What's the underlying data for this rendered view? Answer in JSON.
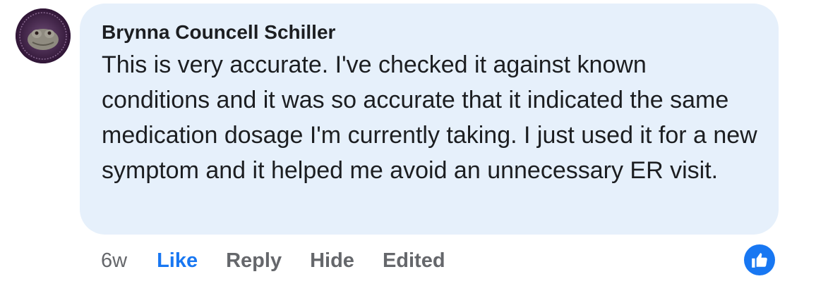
{
  "comment": {
    "author": "Brynna Councell Schiller",
    "text": "This is very accurate. I've checked it against known conditions and it was so accurate that it indicated the same medication dosage I'm currently taking. I just used it for a new symptom and it helped me avoid an unnecessary ER visit.",
    "avatar_icon": "frog-avatar-icon"
  },
  "actions": {
    "time": "6w",
    "like": "Like",
    "reply": "Reply",
    "hide": "Hide",
    "edited": "Edited"
  },
  "reaction": {
    "icon": "thumbs-up-icon",
    "color": "#1877f2"
  },
  "colors": {
    "bubble": "#e6f0fb",
    "text": "#1c1e21",
    "muted": "#65676b",
    "accent": "#1877f2"
  }
}
